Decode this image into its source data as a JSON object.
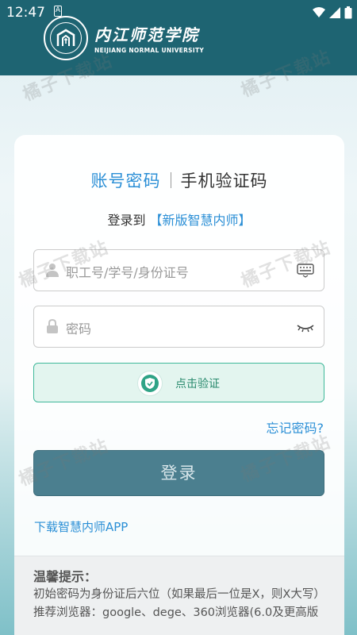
{
  "status_bar": {
    "time": "12:47",
    "notification_letter": "A"
  },
  "header": {
    "school_name_cn": "内江师范学院",
    "school_name_en": "NEIJIANG NORMAL UNIVERSITY"
  },
  "login": {
    "tab_account": "账号密码",
    "tab_phone": "手机验证码",
    "login_to_prefix": "登录到",
    "login_to_target": "【新版智慧内师】",
    "username_placeholder": "职工号/学号/身份证号",
    "password_placeholder": "密码",
    "verify_label": "点击验证",
    "forgot_password": "忘记密码?",
    "login_button": "登录",
    "download_app": "下载智慧内师APP"
  },
  "tips": {
    "title": "温馨提示：",
    "line1": "初始密码为身份证后六位（如果最后一位是X，则X大写）",
    "line2": "推荐浏览器：google、dege、360浏览器(6.0及更高版"
  },
  "watermark": "橘子下载站",
  "colors": {
    "header": "#1e6472",
    "accent_blue": "#2b8fd6",
    "verify_green": "#2fa386",
    "login_button": "#4b7f8f"
  }
}
